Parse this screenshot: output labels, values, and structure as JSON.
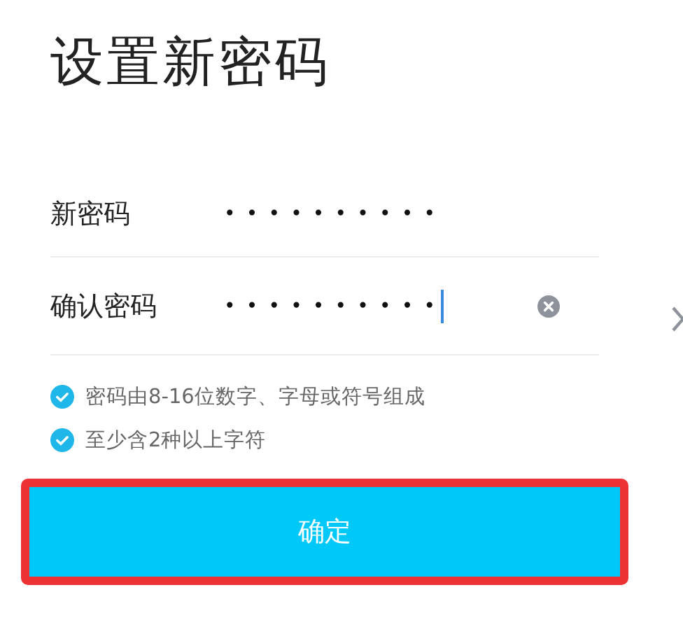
{
  "title": "设置新密码",
  "fields": [
    {
      "label": "新密码",
      "value": "••••••••••",
      "focused": false,
      "clearable": false
    },
    {
      "label": "确认密码",
      "value": "••••••••••",
      "focused": true,
      "clearable": true
    }
  ],
  "rules": [
    {
      "text": "密码由8-16位数字、字母或符号组成",
      "checked": true
    },
    {
      "text": "至少含2种以上字符",
      "checked": true
    }
  ],
  "submit": {
    "label": "确定",
    "highlighted": true
  }
}
